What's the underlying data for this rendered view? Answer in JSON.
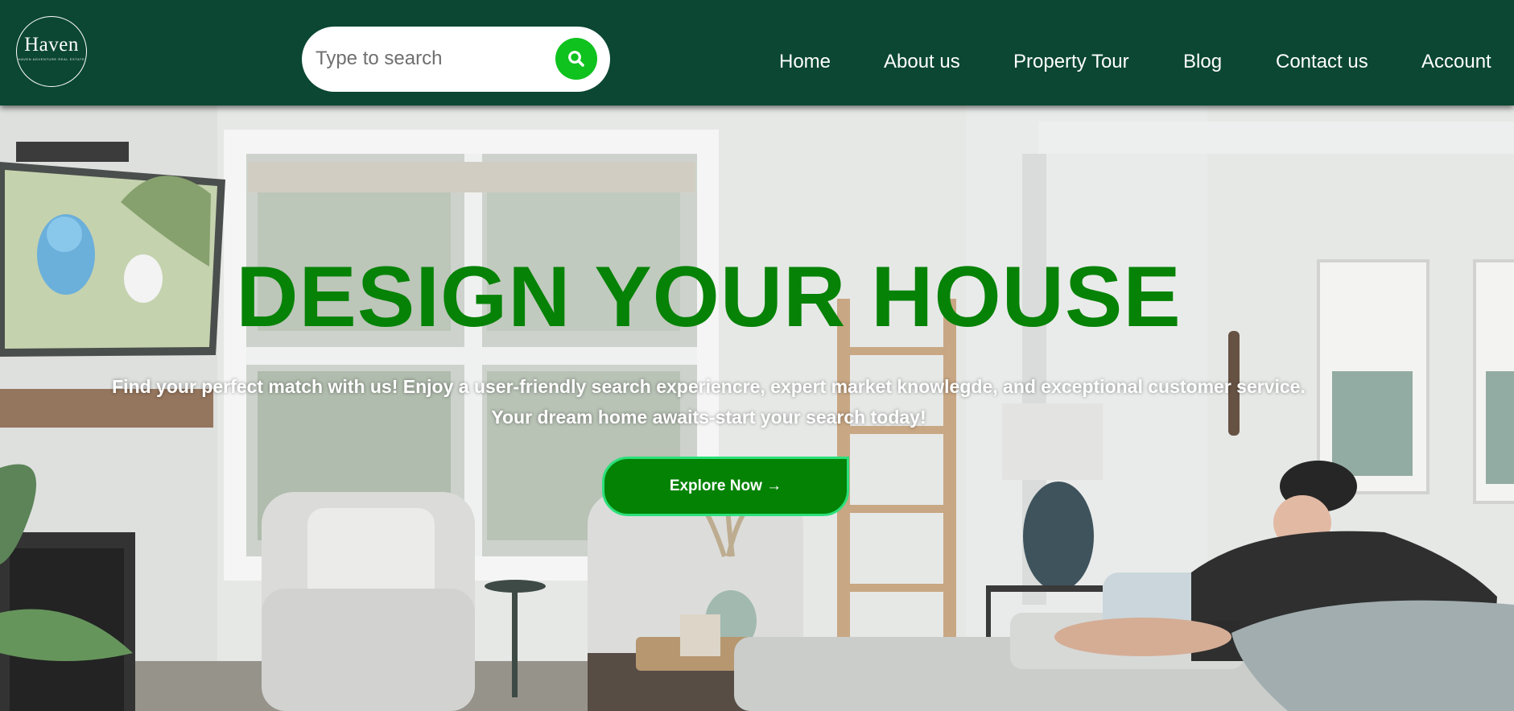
{
  "brand": {
    "name": "Haven",
    "tagline": "HAVEN ADVENTURE REAL ESTATE",
    "header_color": "#0b4732"
  },
  "search": {
    "placeholder": "Type to search",
    "button_color": "#0fc21e",
    "icon": "search-icon"
  },
  "nav": {
    "items": [
      {
        "label": "Home"
      },
      {
        "label": "About us"
      },
      {
        "label": "Property Tour"
      },
      {
        "label": "Blog"
      },
      {
        "label": "Contact us"
      },
      {
        "label": "Account"
      }
    ]
  },
  "hero": {
    "title": "DESIGN YOUR HOUSE",
    "title_color": "#068206",
    "subtitle_line1": "Find your perfect match with us! Enjoy a user-friendly search experiencre, expert market knowlegde, and exceptional customer service.",
    "subtitle_line2": "Your dream home awaits-start your search today!",
    "cta_label": "Explore Now →",
    "cta_color": "#048204",
    "cta_border_color": "#2be07a",
    "background": "living-room-photo"
  }
}
